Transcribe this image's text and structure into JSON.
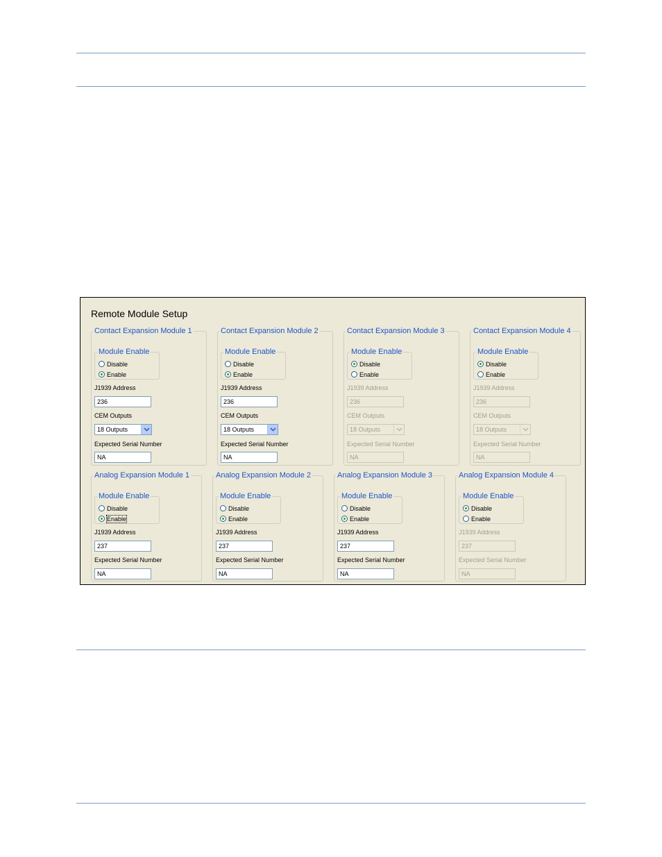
{
  "panel": {
    "title": "Remote Module Setup",
    "colors": {
      "background": "#ece9d8",
      "legend": "#1e55c8",
      "selected_radio": "#21a121",
      "rule": "#7a9cc6"
    },
    "contact_modules": [
      {
        "title": "Contact Expansion Module 1",
        "enable_group": "Module Enable",
        "disable_label": "Disable",
        "enable_label": "Enable",
        "selected": "enable",
        "address_label": "J1939 Address",
        "address": "236",
        "outputs_label": "CEM Outputs",
        "outputs": "18 Outputs",
        "serial_label": "Expected Serial Number",
        "serial": "NA"
      },
      {
        "title": "Contact Expansion Module 2",
        "enable_group": "Module Enable",
        "disable_label": "Disable",
        "enable_label": "Enable",
        "selected": "enable",
        "address_label": "J1939 Address",
        "address": "236",
        "outputs_label": "CEM Outputs",
        "outputs": "18 Outputs",
        "serial_label": "Expected Serial Number",
        "serial": "NA"
      },
      {
        "title": "Contact Expansion Module 3",
        "enable_group": "Module Enable",
        "disable_label": "Disable",
        "enable_label": "Enable",
        "selected": "disable",
        "address_label": "J1939 Address",
        "address": "236",
        "outputs_label": "CEM Outputs",
        "outputs": "18 Outputs",
        "serial_label": "Expected Serial Number",
        "serial": "NA"
      },
      {
        "title": "Contact Expansion Module 4",
        "enable_group": "Module Enable",
        "disable_label": "Disable",
        "enable_label": "Enable",
        "selected": "disable",
        "address_label": "J1939 Address",
        "address": "236",
        "outputs_label": "CEM Outputs",
        "outputs": "18 Outputs",
        "serial_label": "Expected Serial Number",
        "serial": "NA"
      }
    ],
    "analog_modules": [
      {
        "title": "Analog Expansion Module 1",
        "enable_group": "Module Enable",
        "disable_label": "Disable",
        "enable_label": "Enable",
        "selected": "enable",
        "address_label": "J1939 Address",
        "address": "237",
        "serial_label": "Expected Serial Number",
        "serial": "NA"
      },
      {
        "title": "Analog Expansion Module 2",
        "enable_group": "Module Enable",
        "disable_label": "Disable",
        "enable_label": "Enable",
        "selected": "enable",
        "address_label": "J1939 Address",
        "address": "237",
        "serial_label": "Expected Serial Number",
        "serial": "NA"
      },
      {
        "title": "Analog Expansion Module 3",
        "enable_group": "Module Enable",
        "disable_label": "Disable",
        "enable_label": "Enable",
        "selected": "enable",
        "address_label": "J1939 Address",
        "address": "237",
        "serial_label": "Expected Serial Number",
        "serial": "NA"
      },
      {
        "title": "Analog Expansion Module 4",
        "enable_group": "Module Enable",
        "disable_label": "Disable",
        "enable_label": "Enable",
        "selected": "disable",
        "address_label": "J1939 Address",
        "address": "237",
        "serial_label": "Expected Serial Number",
        "serial": "NA"
      }
    ],
    "icons": {
      "dropdown_arrow": "chevron-down-icon",
      "radio": "radio-button-icon"
    }
  }
}
